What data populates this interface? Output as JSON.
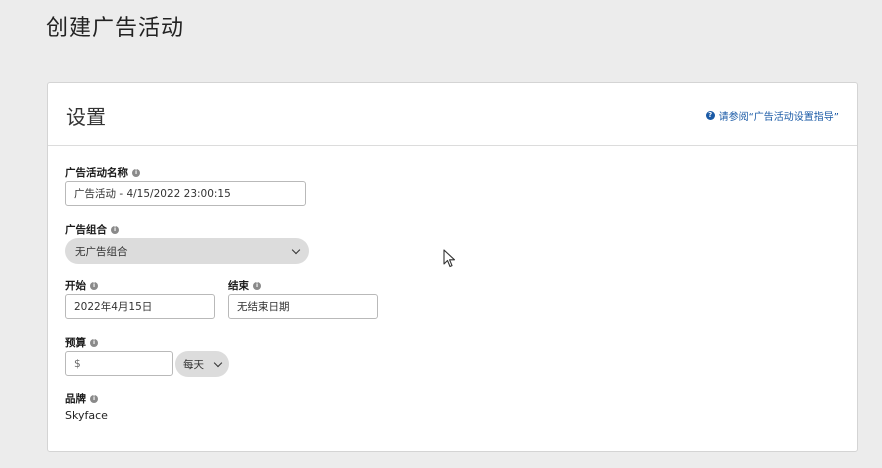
{
  "page": {
    "title": "创建广告活动"
  },
  "settings": {
    "title": "设置",
    "help_link": "请参阅“广告活动设置指导”"
  },
  "fields": {
    "campaign_name": {
      "label": "广告活动名称",
      "value": "广告活动 - 4/15/2022 23:00:15"
    },
    "ad_group": {
      "label": "广告组合",
      "value": "无广告组合"
    },
    "start": {
      "label": "开始",
      "value": "2022年4月15日"
    },
    "end": {
      "label": "结束",
      "value": "无结束日期"
    },
    "budget": {
      "label": "预算",
      "placeholder": "$",
      "period": "每天"
    },
    "brand": {
      "label": "品牌",
      "value": "Skyface"
    }
  },
  "icons": {
    "help": "help-circle-icon",
    "info": "info-icon",
    "dropdown": "chevron-down-icon",
    "cursor": "mouse-pointer-icon"
  },
  "colors": {
    "link": "#1a5aa6",
    "background": "#ececec",
    "card": "#ffffff",
    "select_bg": "#dcdcdc"
  }
}
